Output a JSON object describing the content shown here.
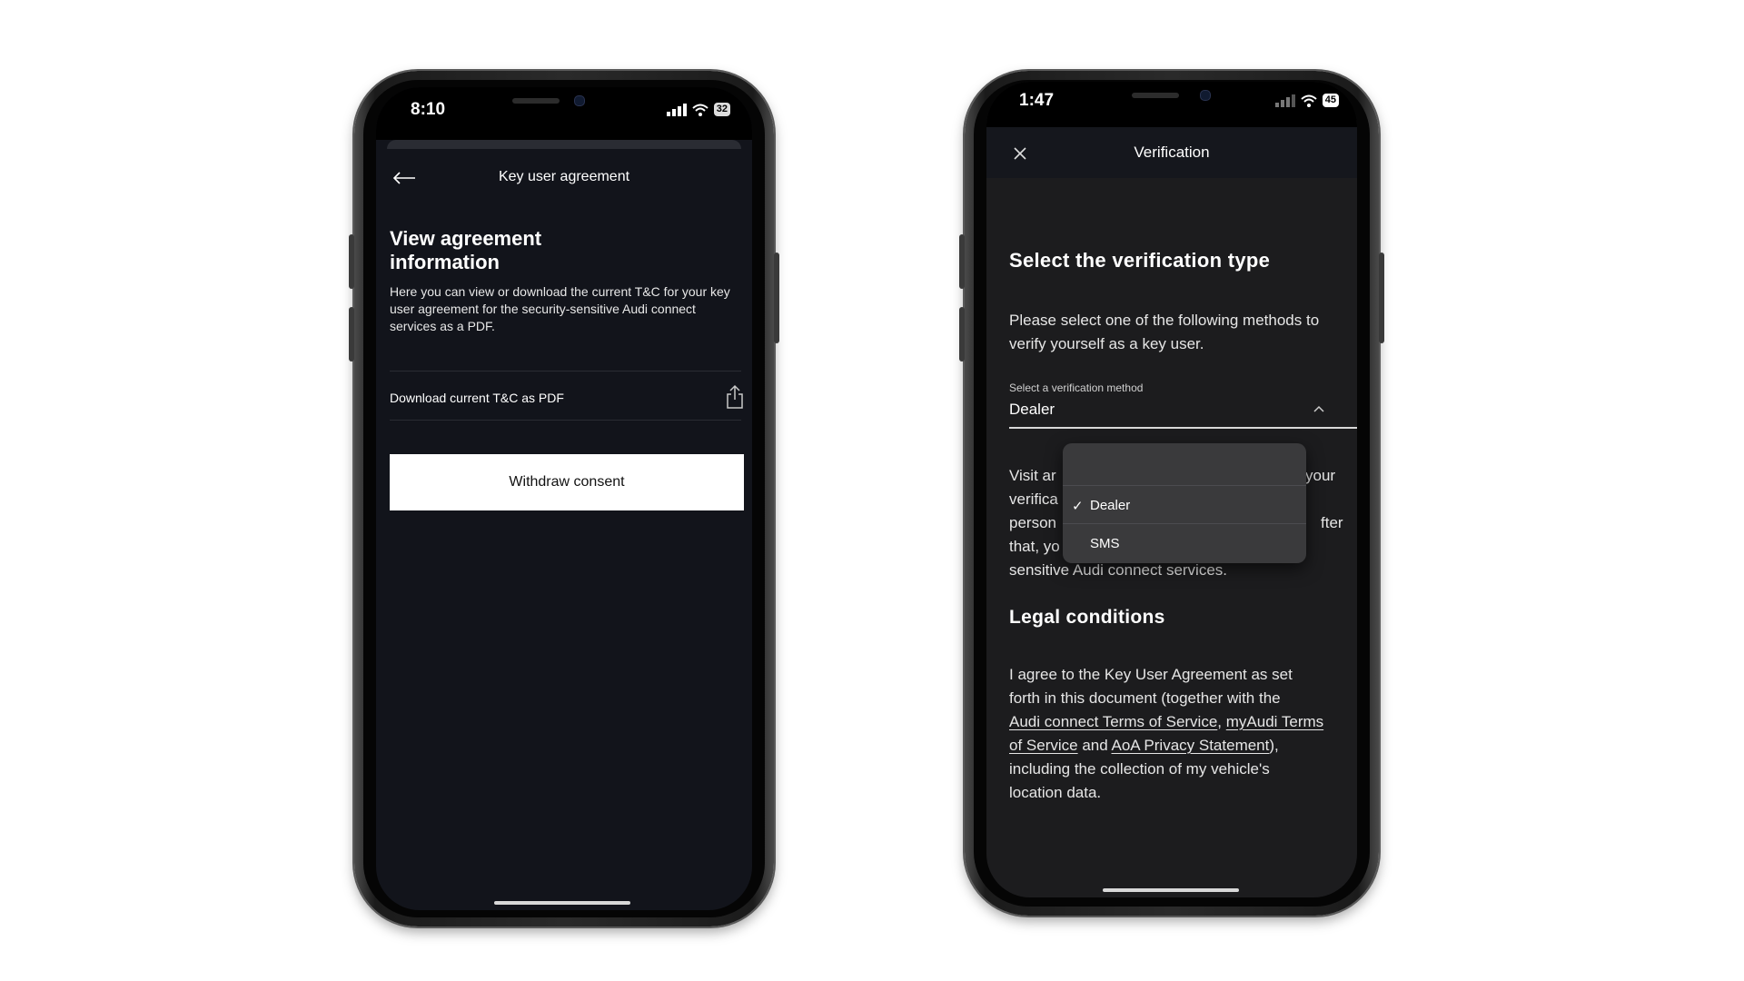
{
  "left_phone": {
    "status_time": "8:10",
    "battery": "32",
    "header_title": "Key user agreement",
    "heading": "View agreement information",
    "description": "Here you can view or download the current T&C for your key user agreement for the security-sensitive Audi connect services as a PDF.",
    "download_label": "Download current T&C as PDF",
    "withdraw_label": "Withdraw consent",
    "icons": {
      "back": "back-arrow-icon",
      "share": "share-icon"
    }
  },
  "right_phone": {
    "status_time": "1:47",
    "battery": "45",
    "header_title": "Verification",
    "heading": "Select the verification type",
    "intro": "Please select one of the following methods to verify yourself as a key user.",
    "select_label": "Select a verification method",
    "select_value": "Dealer",
    "options": [
      {
        "label": "Dealer",
        "selected": true
      },
      {
        "label": "SMS",
        "selected": false
      }
    ],
    "body_fragments": {
      "l1a": "Visit ar",
      "l1b": "your",
      "l2": "verifica",
      "l3a": "person",
      "l3b": "fter",
      "l4": "that, yo",
      "l5": "sensitive Audi connect services."
    },
    "legal_heading": "Legal conditions",
    "legal_text_1": "I agree to the Key User Agreement as set",
    "legal_text_2": "forth in this document (together with the",
    "link_audi_tos": "Audi connect Terms of Service",
    "comma": ",",
    "link_myaudi_1": "myAudi Terms",
    "link_myaudi_2": "of Service",
    "and_text": "and",
    "link_aoa": "AoA Privacy Statement",
    "after_link": "),",
    "legal_text_3": "including the collection of my vehicle's",
    "legal_text_4": "location data.",
    "icons": {
      "close": "close-icon",
      "chevron": "chevron-up-icon",
      "check": "checkmark-icon"
    }
  },
  "colors": {
    "screen_bg": "#12141b",
    "right_screen_bg": "#1c1c1e",
    "accent_white": "#ffffff"
  }
}
